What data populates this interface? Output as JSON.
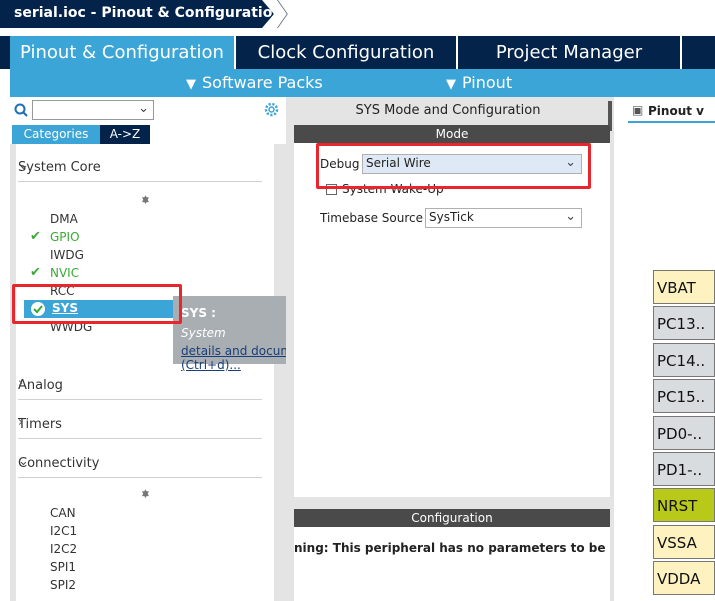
{
  "breadcrumb": {
    "file": "serial.ioc - Pinout & Configuration"
  },
  "tabs": [
    "Pinout & Configuration",
    "Clock Configuration",
    "Project Manager"
  ],
  "subbar": {
    "software_packs": "Software Packs",
    "pinout": "Pinout"
  },
  "left": {
    "category_tab": "Categories",
    "az_tab": "A->Z",
    "groups": {
      "system_core": "System Core",
      "analog": "Analog",
      "timers": "Timers",
      "connectivity": "Connectivity"
    },
    "system_core_items": [
      "DMA",
      "GPIO",
      "IWDG",
      "NVIC",
      "RCC",
      "SYS",
      "WWDG"
    ],
    "connectivity_items": [
      "CAN",
      "I2C1",
      "I2C2",
      "SPI1",
      "SPI2"
    ],
    "tooltip": {
      "title": "SYS :",
      "subtitle": "System",
      "link": "details and documentation (Ctrl+d)..."
    }
  },
  "mid": {
    "header": "SYS Mode and Configuration",
    "mode_bar": "Mode",
    "debug_label": "Debug",
    "debug_value": "Serial Wire",
    "wakeup_label": "System Wake-Up",
    "timebase_label": "Timebase Source",
    "timebase_value": "SysTick",
    "config_bar": "Configuration",
    "warning": "ning: This peripheral has no parameters to be con"
  },
  "right": {
    "tab": "Pinout v",
    "pins": [
      {
        "label": "VBAT",
        "color": "#fdf2c0"
      },
      {
        "label": "PC13..",
        "color": "#d9dcdf"
      },
      {
        "label": "PC14..",
        "color": "#d9dcdf"
      },
      {
        "label": "PC15..",
        "color": "#d9dcdf"
      },
      {
        "label": "PD0-..",
        "color": "#d9dcdf"
      },
      {
        "label": "PD1-..",
        "color": "#d9dcdf"
      },
      {
        "label": "NRST",
        "color": "#b9c91a"
      },
      {
        "label": "VSSA",
        "color": "#fdf2c0"
      },
      {
        "label": "VDDA",
        "color": "#fdf2c0"
      }
    ]
  },
  "colors": {
    "accent": "#3ca5d8",
    "navy": "#03234b",
    "highlight": "#e8262b",
    "enabled": "#3aaa35"
  }
}
